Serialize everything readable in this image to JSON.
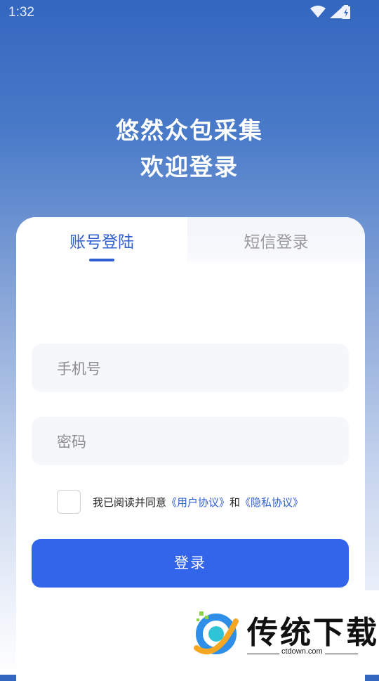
{
  "status_bar": {
    "time": "1:32"
  },
  "header": {
    "title_line1": "悠然众包采集",
    "title_line2": "欢迎登录"
  },
  "tabs": [
    {
      "label": "账号登陆",
      "active": true
    },
    {
      "label": "短信登录",
      "active": false
    }
  ],
  "form": {
    "phone_placeholder": "手机号",
    "phone_value": "",
    "password_placeholder": "密码",
    "password_value": "",
    "agree_checked": false,
    "agree_prefix": "我已阅读并同意",
    "user_agreement": "《用户协议》",
    "and_word": "和",
    "privacy_agreement": "《隐私协议》",
    "login_label": "登录"
  },
  "watermark": {
    "brand": "传统下载",
    "url": "ctdown.com"
  },
  "colors": {
    "accent": "#3265ea",
    "tab_active": "#2f5fd0",
    "bg_top": "#3366bf"
  }
}
